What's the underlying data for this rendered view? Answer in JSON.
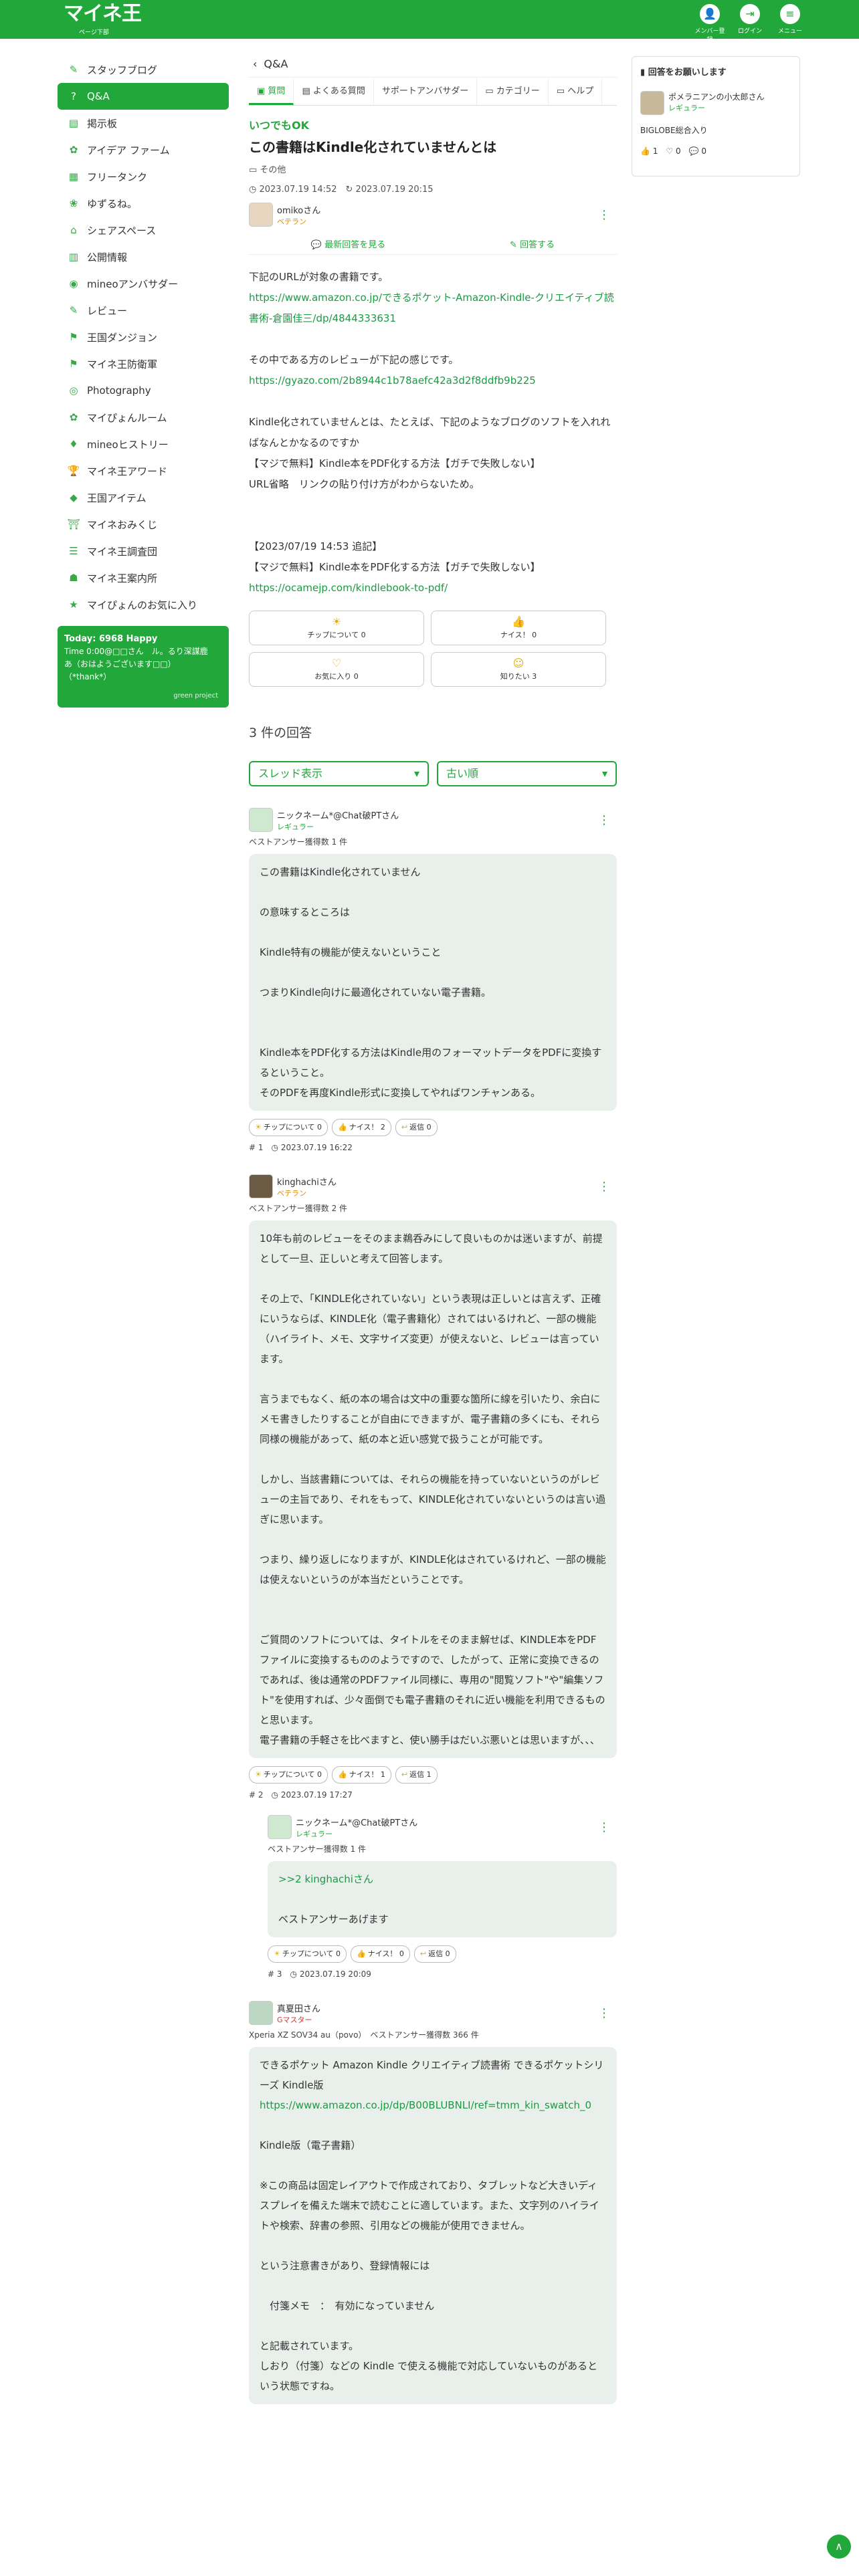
{
  "header": {
    "logo": "マイネ王",
    "logo_sub": "ページ下部",
    "buttons": [
      {
        "label": "メンバー登録",
        "icon": "user-plus-icon"
      },
      {
        "label": "ログイン",
        "icon": "login-icon"
      },
      {
        "label": "メニュー",
        "icon": "menu-icon"
      }
    ]
  },
  "sidebar": {
    "items": [
      "スタッフブログ",
      "Q&A",
      "掲示板",
      "アイデア ファーム",
      "フリータンク",
      "ゆずるね。",
      "シェアスペース",
      "公開情報",
      "mineoアンバサダー",
      "レビュー",
      "王国ダンジョン",
      "マイネ王防衛軍",
      "Photography",
      "マイぴょんルーム",
      "mineoヒストリー",
      "マイネ王アワード",
      "王国アイテム",
      "マイネおみくじ",
      "マイネ王調査団",
      "マイネ王案内所",
      "マイぴょんのお気に入り"
    ],
    "today": {
      "title": "Today: 6968 Happy",
      "line1": "Time 0:00@□□さん　ル。るり深謀鹿",
      "line2": "あ（おはようございます□□）",
      "line3": "（*thank*）",
      "brand": "green project"
    }
  },
  "main": {
    "back_label": "Q&A",
    "tabs": [
      "質問",
      "よくある質問",
      "サポートアンバサダー",
      "カテゴリー",
      "ヘルプ"
    ],
    "question": {
      "label": "いつでもOK",
      "title": "この書籍はKindle化されていませんとは",
      "category": "その他",
      "posted": "2023.07.19 14:52",
      "updated": "2023.07.19 20:15",
      "user": "omikoさん",
      "rank": "ベテラン",
      "action_best": "最新回答を見る",
      "action_answer": "回答する",
      "body": [
        "下記のURLが対象の書籍です。",
        "https://www.amazon.co.jp/できるポケット-Amazon-Kindle-クリエイティブ読書術-倉園佳三/dp/4844333631",
        "",
        "その中である方のレビューが下記の感じです。",
        "https://gyazo.com/2b8944c1b78aefc42a3d2f8ddfb9b225",
        "",
        "Kindle化されていませんとは、たとえば、下記のようなブログのソフトを入れればなんとかなるのですか",
        "【マジで無料】Kindle本をPDF化する方法【ガチで失敗しない】",
        "URL省略　リンクの貼り付け方がわからないため。",
        "",
        "",
        "【2023/07/19 14:53 追記】",
        "【マジで無料】Kindle本をPDF化する方法【ガチで失敗しない】",
        "https://ocamejp.com/kindlebook-to-pdf/"
      ],
      "reactions": [
        "チップについて 0",
        "ナイス！ 0",
        "お気に入り 0",
        "知りたい 3"
      ]
    },
    "answer_count": "3 件の回答",
    "sort1": "スレッド表示",
    "sort2": "古い順",
    "answers": [
      {
        "user": "ニックネーム*@Chat破PTさん",
        "rank": "レギュラー",
        "best": "ベストアンサー獲得数 1 件",
        "body": [
          "この書籍はKindle化されていません",
          "",
          "の意味するところは",
          "",
          "Kindle特有の機能が使えないということ",
          "",
          "つまりKindle向けに最適化されていない電子書籍。",
          "",
          "",
          "Kindle本をPDF化する方法はKindle用のフォーマットデータをPDFに変換するということ。",
          "そのPDFを再度Kindle形式に変換してやればワンチャンある。"
        ],
        "chips": [
          "チップについて 0",
          "ナイス！ 2",
          "返信 0"
        ],
        "num": "# 1",
        "date": "2023.07.19 16:22"
      },
      {
        "user": "kinghachiさん",
        "rank": "ベテラン",
        "best": "ベストアンサー獲得数 2 件",
        "body": [
          "10年も前のレビューをそのまま鵜呑みにして良いものかは迷いますが、前提として一旦、正しいと考えて回答します。",
          "",
          "その上で、「KINDLE化されていない」という表現は正しいとは言えず、正確にいうならば、KINDLE化（電子書籍化）されてはいるけれど、一部の機能（ハイライト、メモ、文字サイズ変更）が使えないと、レビューは言っています。",
          "",
          "言うまでもなく、紙の本の場合は文中の重要な箇所に線を引いたり、余白にメモ書きしたりすることが自由にできますが、電子書籍の多くにも、それら同様の機能があって、紙の本と近い感覚で扱うことが可能です。",
          "",
          "しかし、当該書籍については、それらの機能を持っていないというのがレビューの主旨であり、それをもって、KINDLE化されていないというのは言い過ぎに思います。",
          "",
          "つまり、繰り返しになりますが、KINDLE化はされているけれど、一部の機能は使えないというのが本当だということです。",
          "",
          "",
          "ご質問のソフトについては、タイトルをそのまま解せば、KINDLE本をPDFファイルに変換するもののようですので、したがって、正常に変換できるのであれば、後は通常のPDFファイル同様に、専用の\"閲覧ソフト\"や\"編集ソフト\"を使用すれば、少々面倒でも電子書籍のそれに近い機能を利用できるものと思います。",
          "電子書籍の手軽さを比べますと、使い勝手はだいぶ悪いとは思いますが、、、"
        ],
        "chips": [
          "チップについて 0",
          "ナイス！ 1",
          "返信 1"
        ],
        "num": "# 2",
        "date": "2023.07.19 17:27"
      },
      {
        "user": "ニックネーム*@Chat破PTさん",
        "rank": "レギュラー",
        "best": "ベストアンサー獲得数 1 件",
        "body": [
          ">>2 kinghachiさん",
          "",
          "ベストアンサーあげます"
        ],
        "chips": [
          "チップについて 0",
          "ナイス！ 0",
          "返信 0"
        ],
        "num": "# 3",
        "date": "2023.07.19 20:09"
      },
      {
        "user": "真夏田さん",
        "rank": "Gマスター",
        "best": "Xperia XZ SOV34 au（povo）　ベストアンサー獲得数 366 件",
        "body": [
          "できるポケット Amazon Kindle クリエイティブ読書術 できるポケットシリーズ Kindle版",
          "https://www.amazon.co.jp/dp/B00BLUBNLI/ref=tmm_kin_swatch_0",
          "",
          "Kindle版（電子書籍）",
          "",
          "※この商品は固定レイアウトで作成されており、タブレットなど大きいディスプレイを備えた端末で読むことに適しています。また、文字列のハイライトや検索、辞書の参照、引用などの機能が使用できません。",
          "",
          "という注意書きがあり、登録情報には",
          "",
          "　付箋メモ　：　有効になっていません",
          "",
          "と記載されています。",
          "しおり（付箋）などの Kindle で使える機能で対応していないものがあるという状態ですね。"
        ]
      }
    ]
  },
  "right": {
    "title": "回答をお願いします",
    "user": "ポメラニアンの小太郎さん",
    "rank": "レギュラー",
    "text": "BIGLOBE総合入り",
    "stats": [
      "1",
      "0",
      "0"
    ]
  }
}
